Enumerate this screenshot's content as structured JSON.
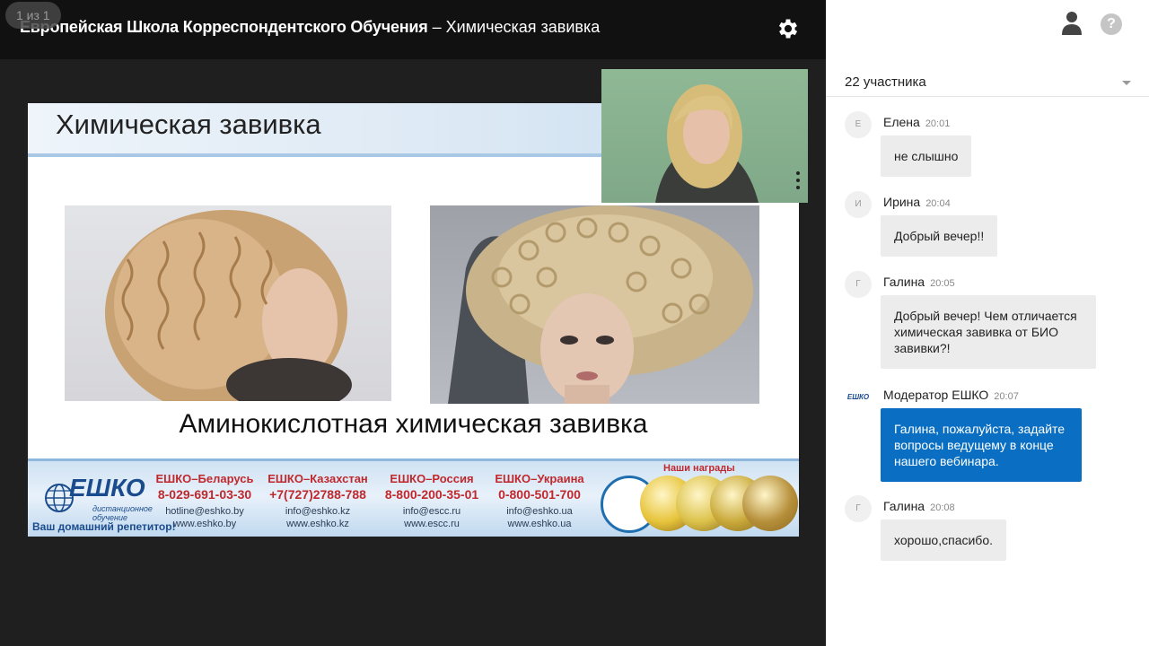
{
  "header": {
    "page_counter": "1 из 1",
    "school": "Европейская Школа Корреспондентского Обучения",
    "separator": " – ",
    "topic": "Химическая завивка"
  },
  "slide": {
    "title": "Химическая завивка",
    "subtitle": "Аминокислотная химическая завивка",
    "logo": {
      "word": "ЕШКО",
      "sub": "дистанционное обучение",
      "tagline": "Ваш домашний репетитор!"
    },
    "contacts": [
      {
        "name": "ЕШКО–Беларусь",
        "phone": "8-029-691-03-30",
        "email": "hotline@eshko.by",
        "site": "www.eshko.by"
      },
      {
        "name": "ЕШКО–Казахстан",
        "phone": "+7(727)2788-788",
        "email": "info@eshko.kz",
        "site": "www.eshko.kz"
      },
      {
        "name": "ЕШКО–Россия",
        "phone": "8-800-200-35-01",
        "email": "info@escc.ru",
        "site": "www.escc.ru"
      },
      {
        "name": "ЕШКО–Украина",
        "phone": "0-800-501-700",
        "email": "info@eshko.ua",
        "site": "www.eshko.ua"
      }
    ],
    "awards_label": "Наши награды",
    "medal_colors": [
      "#1f6fb0",
      "#e7c43a",
      "#dcc24a",
      "#c9a93a",
      "#b68f3a"
    ]
  },
  "chat": {
    "participants": "22 участника",
    "messages": [
      {
        "initial": "Е",
        "name": "Елена",
        "time": "20:01",
        "text": "не слышно",
        "moderator": false
      },
      {
        "initial": "И",
        "name": "Ирина",
        "time": "20:04",
        "text": "Добрый вечер!!",
        "moderator": false
      },
      {
        "initial": "Г",
        "name": "Галина",
        "time": "20:05",
        "text": "Добрый вечер! Чем отличается химическая завивка от БИО завивки?!",
        "moderator": false
      },
      {
        "initial": "ЕШКО",
        "name": "Модератор ЕШКО",
        "time": "20:07",
        "text": "Галина, пожалуйста, задайте вопросы ведущему в конце нашего вебинара.",
        "moderator": true
      },
      {
        "initial": "Г",
        "name": "Галина",
        "time": "20:08",
        "text": "хорошо,спасибо.",
        "moderator": false
      }
    ]
  },
  "colors": {
    "moderator_bubble": "#0a6fc2",
    "user_bubble": "#ececec",
    "accent_red": "#c0282d",
    "brand_blue": "#1a4b8c"
  }
}
